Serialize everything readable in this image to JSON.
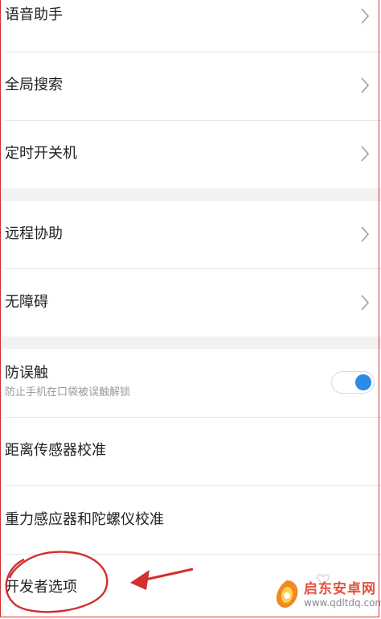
{
  "settings": {
    "voice_assistant": "语音助手",
    "global_search": "全局搜索",
    "scheduled_power": "定时开关机",
    "remote_assist": "远程协助",
    "accessibility": "无障碍",
    "anti_touch": {
      "title": "防误触",
      "subtitle": "防止手机在口袋被误触解锁",
      "enabled": true
    },
    "proximity_calibration": "距离传感器校准",
    "gravity_calibration": "重力感应器和陀螺仪校准",
    "developer_options": "开发者选项"
  },
  "colors": {
    "accent_blue": "#2d8ae8",
    "annotation_red": "#d32f2f",
    "section_gap": "#f2f2f2"
  },
  "watermark": {
    "text": "启东安卓网",
    "url": "www.qdltdq.com"
  }
}
